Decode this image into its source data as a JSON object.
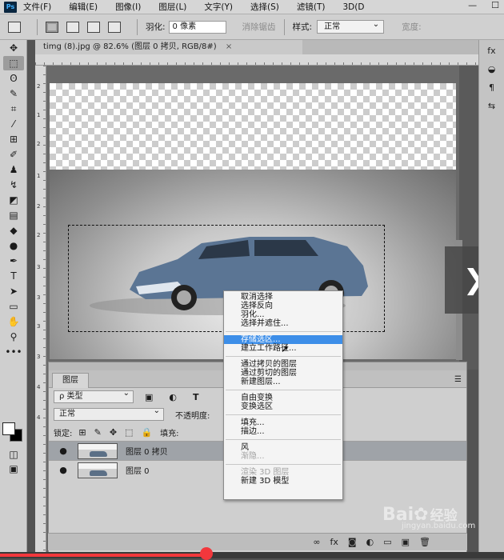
{
  "menubar": {
    "logo": "Ps",
    "items": [
      "文件(F)",
      "编辑(E)",
      "图像(I)",
      "图层(L)",
      "文字(Y)",
      "选择(S)",
      "滤镜(T)",
      "3D(D"
    ],
    "window_controls": [
      "—",
      "☐"
    ]
  },
  "options": {
    "feather_label": "羽化:",
    "feather_value": "0 像素",
    "antialias_label": "消除锯齿",
    "style_label": "样式:",
    "style_value": "正常",
    "width_label": "宽度:"
  },
  "document": {
    "tab_title": "timg (8).jpg @ 82.6% (图层 0 拷贝, RGB/8#)",
    "close_symbol": "×"
  },
  "rulers": {
    "vertical_numbers": [
      "2",
      "1",
      "2",
      "1",
      "2",
      "2",
      "3",
      "3",
      "3",
      "3",
      "4",
      "4"
    ]
  },
  "layers_panel": {
    "tab_label": "图层",
    "filter_label": "ρ 类型",
    "blend_mode": "正常",
    "opacity_label": "不透明度:",
    "lock_label": "锁定:",
    "fill_label": "填充:",
    "layers": [
      {
        "name": "图层 0 拷贝",
        "visible_icon": "●",
        "selected": true
      },
      {
        "name": "图层 0",
        "visible_icon": "●",
        "selected": false
      }
    ]
  },
  "context_menu": {
    "groups": [
      [
        {
          "label": "取消选择",
          "disabled": false,
          "hover": false
        },
        {
          "label": "选择反向",
          "disabled": false,
          "hover": false
        },
        {
          "label": "羽化...",
          "disabled": false,
          "hover": false
        },
        {
          "label": "选择并遮住...",
          "disabled": false,
          "hover": false
        }
      ],
      [
        {
          "label": "存储选区...",
          "disabled": false,
          "hover": true
        },
        {
          "label": "建立工作路径...",
          "disabled": false,
          "hover": false
        }
      ],
      [
        {
          "label": "通过拷贝的图层",
          "disabled": false,
          "hover": false
        },
        {
          "label": "通过剪切的图层",
          "disabled": false,
          "hover": false
        },
        {
          "label": "新建图层...",
          "disabled": false,
          "hover": false
        }
      ],
      [
        {
          "label": "自由变换",
          "disabled": false,
          "hover": false
        },
        {
          "label": "变换选区",
          "disabled": false,
          "hover": false
        }
      ],
      [
        {
          "label": "填充...",
          "disabled": false,
          "hover": false
        },
        {
          "label": "描边...",
          "disabled": false,
          "hover": false
        }
      ],
      [
        {
          "label": "风",
          "disabled": false,
          "hover": false
        },
        {
          "label": "渐隐...",
          "disabled": true,
          "hover": false
        }
      ],
      [
        {
          "label": "渲染 3D 图层",
          "disabled": true,
          "hover": false
        },
        {
          "label": "新建 3D 模型",
          "disabled": false,
          "hover": false
        }
      ]
    ]
  },
  "bottom_bar": {
    "icons": [
      "∞",
      "fx",
      "◙",
      "◐",
      "▭",
      "▣",
      "🗑"
    ]
  },
  "watermark": {
    "brand": "Bai",
    "brand_suffix": "经验",
    "url": "jingyan.baidu.com"
  },
  "video": {
    "progress_percent": 41
  },
  "colors": {
    "menu_hover": "#3d8ee8",
    "progress": "#f2373c"
  }
}
